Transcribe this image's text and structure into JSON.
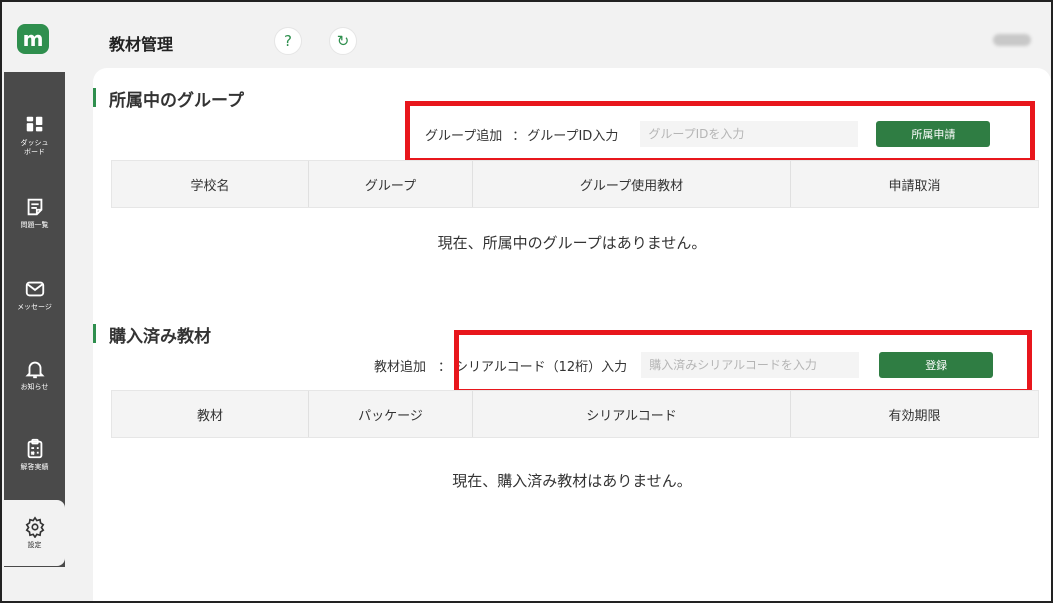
{
  "app": {
    "logo_letter": "m",
    "page_title": "教材管理",
    "help_symbol": "?",
    "refresh_symbol": "↻"
  },
  "sidebar": {
    "items": [
      {
        "label": "ダッシュ\nボード",
        "icon": "dashboard-icon"
      },
      {
        "label": "問題一覧",
        "icon": "document-icon"
      },
      {
        "label": "メッセージ",
        "icon": "mail-icon"
      },
      {
        "label": "お知らせ",
        "icon": "bell-icon"
      },
      {
        "label": "解答実績",
        "icon": "clipboard-icon"
      },
      {
        "label": "設定",
        "icon": "gear-icon"
      }
    ],
    "active": "設定"
  },
  "groups": {
    "title": "所属中のグループ",
    "add_label": "グループ追加",
    "separator": "：",
    "id_label": "グループID入力",
    "input_placeholder": "グループIDを入力",
    "button_label": "所属申請",
    "columns": [
      "学校名",
      "グループ",
      "グループ使用教材",
      "申請取消"
    ],
    "empty_message": "現在、所属中のグループはありません。"
  },
  "materials": {
    "title": "購入済み教材",
    "add_label": "教材追加",
    "separator": "：",
    "code_label": "シリアルコード（12桁）入力",
    "input_placeholder": "購入済みシリアルコードを入力",
    "button_label": "登録",
    "columns": [
      "教材",
      "パッケージ",
      "シリアルコード",
      "有効期限"
    ],
    "empty_message": "現在、購入済み教材はありません。"
  },
  "colors": {
    "brand_green": "#2f8f4e",
    "button_green": "#2f7d43",
    "sidebar_bg": "#4a4a4a",
    "highlight_red": "#e8161c"
  }
}
